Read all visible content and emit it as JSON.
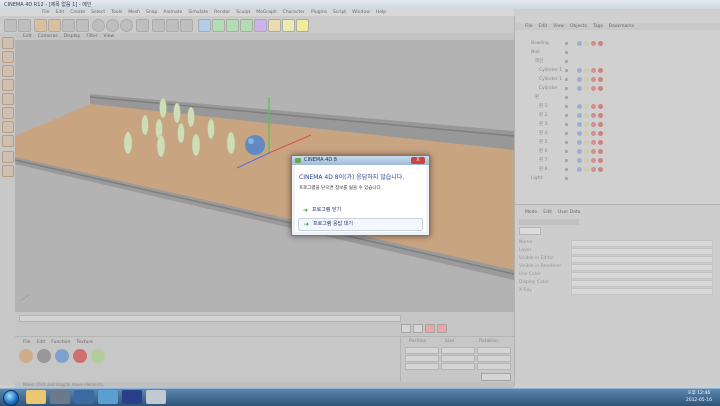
{
  "window": {
    "title": "CINEMA 4D R12 - [제목 없음 1] - 메인"
  },
  "menubar": {
    "items": [
      "File",
      "Edit",
      "Create",
      "Select",
      "Tools",
      "Mesh",
      "Snap",
      "Animate",
      "Simulate",
      "Render",
      "Sculpt",
      "MoGraph",
      "Character",
      "Plugins",
      "Script",
      "Window",
      "Help"
    ]
  },
  "viewport": {
    "menu": [
      "Edit",
      "Cameras",
      "Display",
      "Filter",
      "View"
    ]
  },
  "object_manager": {
    "menu": [
      "File",
      "Edit",
      "View",
      "Objects",
      "Tags",
      "Bookmarks"
    ],
    "objects": [
      {
        "name": "Bowling"
      },
      {
        "name": "Null"
      },
      {
        "name": "레인"
      },
      {
        "name": "Cylinder 1"
      },
      {
        "name": "Cylinder 1"
      },
      {
        "name": "Cylinder"
      },
      {
        "name": "핀"
      },
      {
        "name": "핀 1"
      },
      {
        "name": "핀 2"
      },
      {
        "name": "핀 3"
      },
      {
        "name": "핀 4"
      },
      {
        "name": "핀 5"
      },
      {
        "name": "핀 6"
      },
      {
        "name": "핀 7"
      },
      {
        "name": "핀 8"
      },
      {
        "name": "Light"
      }
    ]
  },
  "attributes": {
    "menu": [
      "Mode",
      "Edit",
      "User Data"
    ],
    "rows": [
      "Name",
      "Layer",
      "Visible in Editor",
      "Visible in Renderer",
      "Use Color",
      "Display Color",
      "X-Ray"
    ]
  },
  "materials": {
    "menu": [
      "File",
      "Edit",
      "Function",
      "Texture"
    ]
  },
  "coordinates": {
    "headers": [
      "Position",
      "Size",
      "Rotation"
    ]
  },
  "status": {
    "text": "Move: Click and drag to move elements."
  },
  "dialog": {
    "title": "CINEMA 4D 8",
    "close_label": "X",
    "headline": "CINEMA 4D 8이(가) 응답하지 않습니다.",
    "subtext": "프로그램을 닫으면 정보를 잃을 수 있습니다.",
    "option_close": "프로그램 닫기",
    "option_wait": "프로그램 응답 대기"
  },
  "taskbar": {
    "clock_time": "오후 12:46",
    "clock_date": "2012-05-16"
  },
  "colors": {
    "dialog_title": "#1e3e8e",
    "taskbar": "#2e5378",
    "lane": "#c29870",
    "ball": "#4a7ab8",
    "pin": "#c9d9ad"
  }
}
